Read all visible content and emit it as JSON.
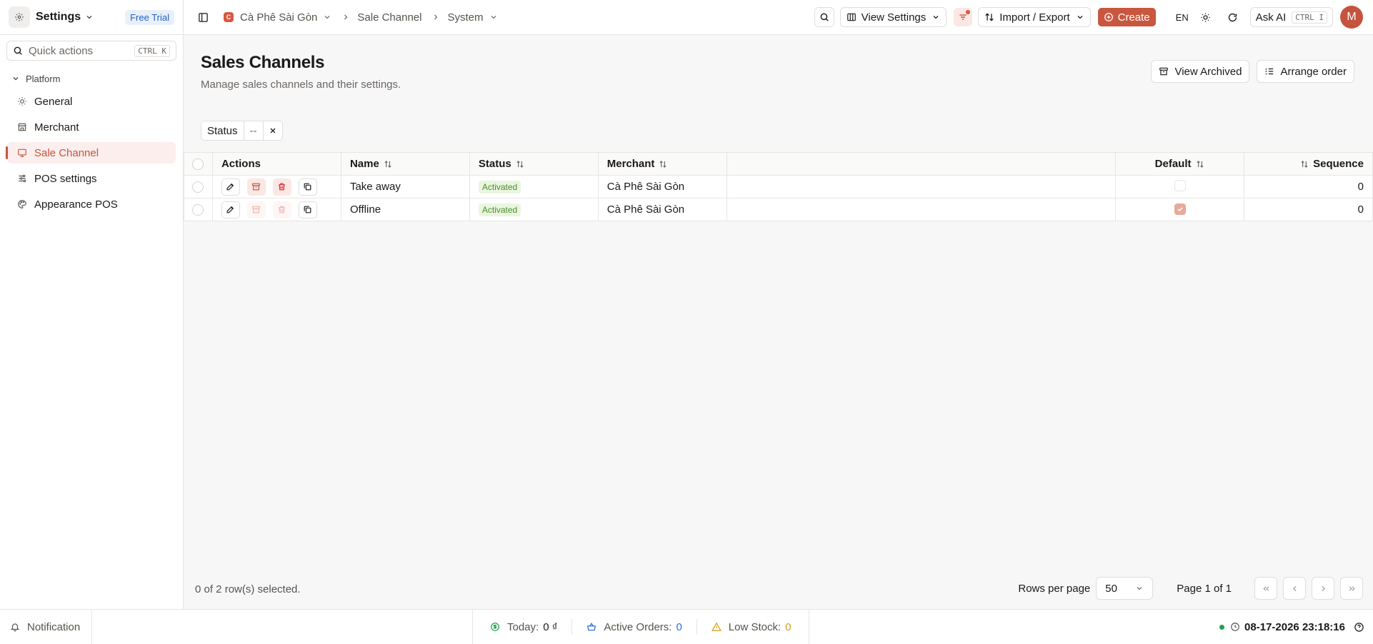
{
  "sidebar": {
    "title": "Settings",
    "trial_badge": "Free Trial",
    "quick_actions": "Quick actions",
    "quick_shortcut": "CTRL K",
    "group": "Platform",
    "items": [
      {
        "label": "General",
        "icon": "sun-icon"
      },
      {
        "label": "Merchant",
        "icon": "store-icon"
      },
      {
        "label": "Sale Channel",
        "icon": "channel-icon",
        "active": true
      },
      {
        "label": "POS settings",
        "icon": "sliders-icon"
      },
      {
        "label": "Appearance POS",
        "icon": "palette-icon"
      }
    ]
  },
  "topbar": {
    "company": "Cà Phê Sài Gòn",
    "company_initial": "C",
    "crumb_page": "Sale Channel",
    "crumb_section": "System",
    "view_settings": "View Settings",
    "import_export": "Import / Export",
    "create": "Create",
    "lang": "EN",
    "ask_ai": "Ask AI",
    "ask_ai_shortcut": "CTRL I",
    "avatar_initial": "M"
  },
  "page": {
    "title": "Sales Channels",
    "subtitle": "Manage sales channels and their settings.",
    "view_archived": "View Archived",
    "arrange_order": "Arrange order"
  },
  "filter": {
    "label": "Status",
    "value": "--"
  },
  "table": {
    "columns": {
      "actions": "Actions",
      "name": "Name",
      "status": "Status",
      "merchant": "Merchant",
      "default": "Default",
      "sequence": "Sequence"
    },
    "rows": [
      {
        "name": "Take away",
        "status": "Activated",
        "merchant": "Cà Phê Sài Gòn",
        "default": false,
        "sequence": "0"
      },
      {
        "name": "Offline",
        "status": "Activated",
        "merchant": "Cà Phê Sài Gòn",
        "default": true,
        "sequence": "0"
      }
    ]
  },
  "footer": {
    "selection": "0 of 2 row(s) selected.",
    "rows_per_page_label": "Rows per page",
    "rows_per_page": "50",
    "page_info": "Page 1 of 1"
  },
  "statusbar": {
    "notification": "Notification",
    "today_label": "Today:",
    "today_value": "0 ₫",
    "active_orders_label": "Active Orders:",
    "active_orders_value": "0",
    "low_stock_label": "Low Stock:",
    "low_stock_value": "0",
    "datetime": "08-17-2026 23:18:16"
  },
  "colors": {
    "accent": "#c4543e",
    "status_green": "#4d8b2c",
    "orders_blue": "#2f6fd1",
    "low_stock_amber": "#d4a017"
  }
}
